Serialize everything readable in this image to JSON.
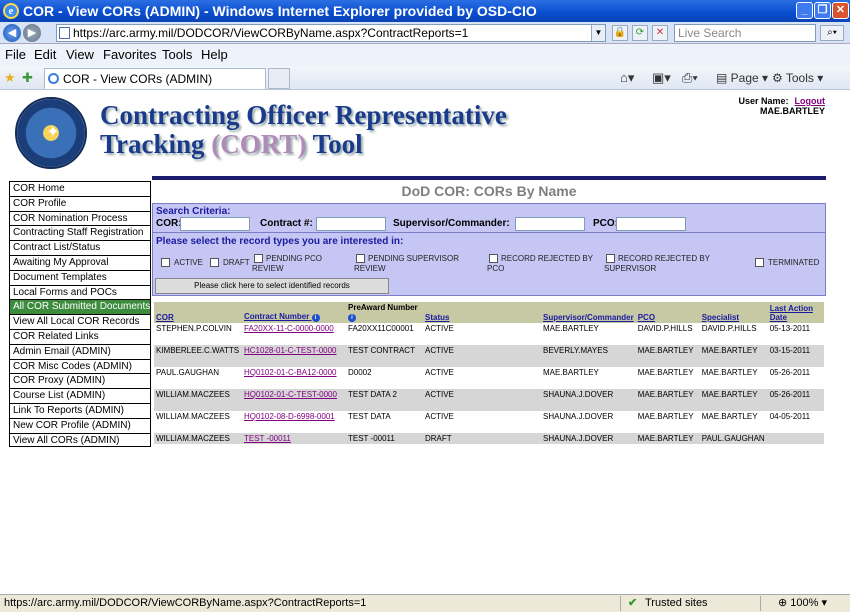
{
  "window": {
    "title": "COR - View CORs (ADMIN) - Windows Internet Explorer provided by OSD-CIO"
  },
  "address": {
    "url": "https://arc.army.mil/DODCOR/ViewCORByName.aspx?ContractReports=1",
    "search_placeholder": "Live Search"
  },
  "menu": [
    "File",
    "Edit",
    "View",
    "Favorites",
    "Tools",
    "Help"
  ],
  "tab": {
    "label": "COR - View CORs (ADMIN)"
  },
  "toolbar": {
    "page": "Page",
    "tools": "Tools"
  },
  "banner": {
    "title_line1": "Contracting Officer Representative",
    "title_line2a": "Tracking ",
    "title_cort": "(CORT)",
    "title_line2b": " Tool",
    "seal_text": "DEPARTMENT OF DEFENSE"
  },
  "user": {
    "label": "User Name:",
    "logout": "Logout",
    "name": "MAE.BARTLEY"
  },
  "nav": [
    "COR Home",
    "COR Profile",
    "COR Nomination Process",
    "Contracting Staff Registration",
    "Contract List/Status",
    "Awaiting My Approval",
    "Document Templates",
    "Local Forms and POCs",
    "All COR Submitted Documents",
    "View All Local COR Records",
    "COR Related Links",
    "Admin Email (ADMIN)",
    "COR Misc Codes (ADMIN)",
    "COR Proxy (ADMIN)",
    "Course List (ADMIN)",
    "Link To Reports (ADMIN)",
    "New COR Profile (ADMIN)",
    "View All CORs (ADMIN)"
  ],
  "nav_selected_index": 8,
  "page_heading": "DoD COR: CORs By Name",
  "criteria": {
    "title": "Search Criteria:",
    "cor": "COR:",
    "contract": "Contract #:",
    "supervisor": "Supervisor/Commander:",
    "pco": "PCO:"
  },
  "record_types": {
    "prompt": "Please select the record types you are interested in:",
    "active": "ACTIVE",
    "draft": "DRAFT",
    "pending_pco": "PENDING PCO REVIEW",
    "pending_sup": "PENDING SUPERVISOR REVIEW",
    "rej_pco": "RECORD REJECTED BY PCO",
    "rej_sup": "RECORD REJECTED BY SUPERVISOR",
    "terminated": "TERMINATED",
    "button": "Please click here to select identified records"
  },
  "table": {
    "headers": [
      "COR",
      "Contract Number",
      "PreAward Number",
      "Status",
      "Supervisor/Commander",
      "PCO",
      "Specialist",
      "Last Action Date"
    ],
    "rows": [
      {
        "cor": "STEPHEN.P.COLVIN",
        "contract": "FA20XX-11-C-0000-0000",
        "preaward": "FA20XX11C00001",
        "status": "ACTIVE",
        "supervisor": "MAE.BARTLEY",
        "pco": "DAVID.P.HILLS",
        "specialist": "DAVID.P.HILLS",
        "date": "05-13-2011"
      },
      {
        "cor": "KIMBERLEE.C.WATTS",
        "contract": "HC1028-01-C-TEST-0000",
        "preaward": "TEST CONTRACT",
        "status": "ACTIVE",
        "supervisor": "BEVERLY.MAYES",
        "pco": "MAE.BARTLEY",
        "specialist": "MAE.BARTLEY",
        "date": "03-15-2011"
      },
      {
        "cor": "PAUL.GAUGHAN",
        "contract": "HQ0102-01-C-BA12-0000",
        "preaward": "D0002",
        "status": "ACTIVE",
        "supervisor": "MAE.BARTLEY",
        "pco": "MAE.BARTLEY",
        "specialist": "MAE.BARTLEY",
        "date": "05-26-2011"
      },
      {
        "cor": "WILLIAM.MACZEES",
        "contract": "HQ0102-01-C-TEST-0000",
        "preaward": "TEST DATA 2",
        "status": "ACTIVE",
        "supervisor": "SHAUNA.J.DOVER",
        "pco": "MAE.BARTLEY",
        "specialist": "MAE.BARTLEY",
        "date": "05-26-2011"
      },
      {
        "cor": "WILLIAM.MACZEES",
        "contract": "HQ0102-08-D-6998-0001",
        "preaward": "TEST DATA",
        "status": "ACTIVE",
        "supervisor": "SHAUNA.J.DOVER",
        "pco": "MAE.BARTLEY",
        "specialist": "MAE.BARTLEY",
        "date": "04-05-2011"
      },
      {
        "cor": "WILLIAM.MACZEES",
        "contract": "TEST -00011",
        "preaward": "TEST -00011",
        "status": "DRAFT",
        "supervisor": "SHAUNA.J.DOVER",
        "pco": "MAE.BARTLEY",
        "specialist": "PAUL.GAUGHAN",
        "date": ""
      }
    ]
  },
  "status": {
    "url": "https://arc.army.mil/DODCOR/ViewCORByName.aspx?ContractReports=1",
    "zone": "Trusted sites",
    "zoom": "100%"
  }
}
